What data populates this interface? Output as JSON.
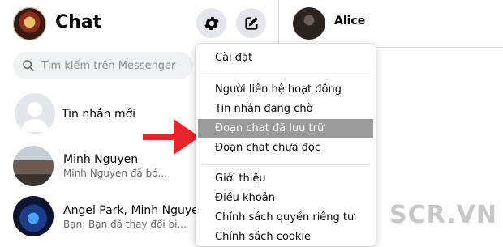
{
  "header": {
    "title": "Chat",
    "settings_icon": "gear-icon",
    "compose_icon": "compose-icon"
  },
  "conversation_header": {
    "name": "Alice"
  },
  "search": {
    "placeholder": "Tìm kiếm trên Messenger",
    "value": ""
  },
  "conversations": [
    {
      "name": "Tin nhắn mới",
      "preview": ""
    },
    {
      "name": "Minh Nguyen",
      "preview": "Minh Nguyen đã bỏ..."
    },
    {
      "name": "Angel Park, Minh Nguyen",
      "preview": "Bạn: Bạn đã thay đổi bi..."
    }
  ],
  "menu": {
    "items": [
      "Cài đặt",
      "Người liên hệ hoạt động",
      "Tin nhắn đang chờ",
      "Đoạn chat đã lưu trữ",
      "Đoạn chat chưa đọc",
      "Giới thiệu",
      "Điều khoản",
      "Chính sách quyền riêng tư",
      "Chính sách cookie"
    ],
    "highlighted": "Đoạn chat đã lưu trữ"
  },
  "colors": {
    "highlight": "#9b9b9b",
    "arrow": "#e8262a",
    "icon_bg": "#e4e6eb"
  },
  "watermark": "SCR.VN"
}
